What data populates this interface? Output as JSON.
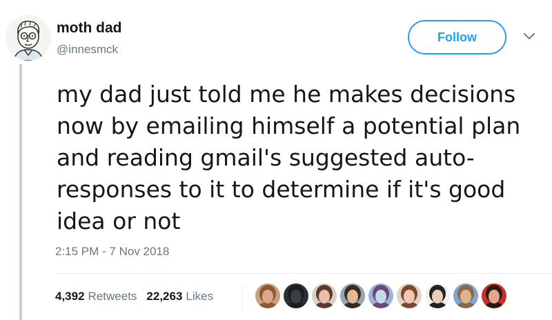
{
  "author": {
    "display_name": "moth dad",
    "handle": "@innesmck",
    "avatar_icon": "cartoon-man-glasses-avatar"
  },
  "follow_label": "Follow",
  "caret_icon": "chevron-down-icon",
  "tweet": {
    "text_lines": [
      "my dad just told me he makes decisions",
      "now by emailing himself a potential plan",
      "and reading gmail's suggested auto-",
      "responses to it to determine if it's good",
      "idea or not"
    ],
    "timestamp": "2:15 PM - 7 Nov 2018"
  },
  "stats": {
    "retweets_count": "4,392",
    "retweets_label": "Retweets",
    "likes_count": "22,263",
    "likes_label": "Likes"
  },
  "likers": [
    {
      "skin": "#d9a98a",
      "hair": "#8a5a35",
      "bg": "#c9a07e"
    },
    {
      "skin": "#3a3f45",
      "hair": "#1a1d21",
      "bg": "#2b3036"
    },
    {
      "skin": "#e8bfa6",
      "hair": "#5a3a2a",
      "bg": "#d8cfc8"
    },
    {
      "skin": "#e3b895",
      "hair": "#3b2a20",
      "bg": "#9aa5ad"
    },
    {
      "skin": "#c7d6ea",
      "hair": "#6b4a73",
      "bg": "#9bb4d8"
    },
    {
      "skin": "#f0c8b0",
      "hair": "#7a4a2e",
      "bg": "#e3d2c4"
    },
    {
      "skin": "#e9cdb8",
      "hair": "#222222",
      "bg": "#f3f1ee"
    },
    {
      "skin": "#d9b48f",
      "hair": "#8a6a4a",
      "bg": "#7fa6cf"
    },
    {
      "skin": "#e6a68e",
      "hair": "#2a1a12",
      "bg": "#c9302c"
    }
  ],
  "colors": {
    "accent": "#1da1f2",
    "text": "#14171a",
    "muted": "#657786",
    "thread_line": "#c4cfd6"
  }
}
